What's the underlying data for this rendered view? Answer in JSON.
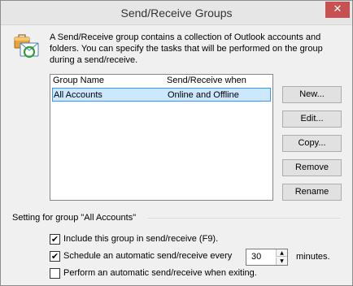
{
  "window": {
    "title": "Send/Receive Groups",
    "close_glyph": "✕",
    "close_color": "#c75050"
  },
  "description": "A Send/Receive group contains a collection of Outlook accounts and folders. You can specify the tasks that will be performed on the group during a send/receive.",
  "info_icon": "send-receive-groups-icon",
  "groups_list": {
    "columns": [
      "Group Name",
      "Send/Receive when"
    ],
    "rows": [
      {
        "name": "All Accounts",
        "when": "Online and Offline",
        "selected": true
      }
    ],
    "selection_color": "#cce8ff"
  },
  "buttons": {
    "new": "New...",
    "edit": "Edit...",
    "copy": "Copy...",
    "remove": "Remove",
    "rename": "Rename"
  },
  "settings": {
    "group_label": "Setting for group \"All Accounts\"",
    "include_label": "Include this group in send/receive (F9).",
    "include_checked": true,
    "schedule_label": "Schedule an automatic send/receive every",
    "schedule_checked": true,
    "schedule_minutes": "30",
    "minutes_label": "minutes.",
    "exit_label": "Perform an automatic send/receive when exiting.",
    "exit_checked": false,
    "check_glyph": "✔"
  }
}
